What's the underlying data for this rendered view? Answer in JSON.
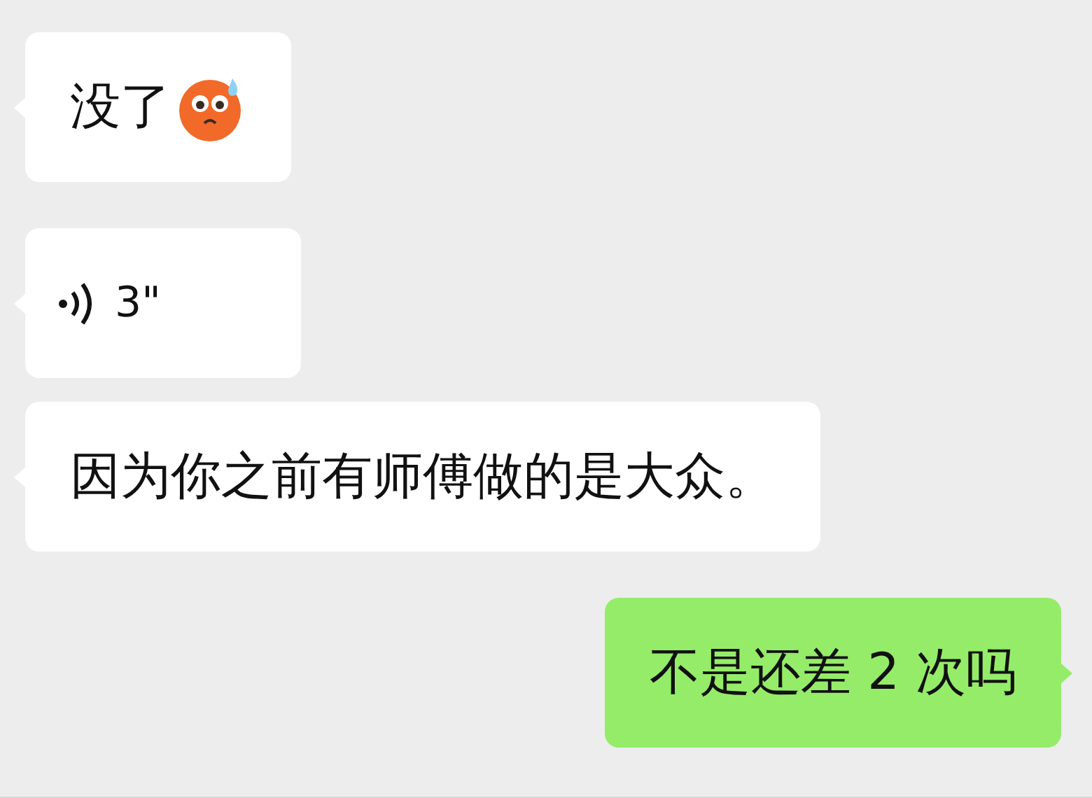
{
  "messages": [
    {
      "outgoing": false,
      "kind": "text",
      "text": "没了",
      "emoji": true
    },
    {
      "outgoing": false,
      "kind": "voice",
      "duration": "3\""
    },
    {
      "outgoing": false,
      "kind": "text",
      "text": "因为你之前有师傅做的是大众。",
      "emoji": false
    },
    {
      "outgoing": true,
      "kind": "text",
      "text": "不是还差 2 次吗",
      "emoji": false
    }
  ]
}
